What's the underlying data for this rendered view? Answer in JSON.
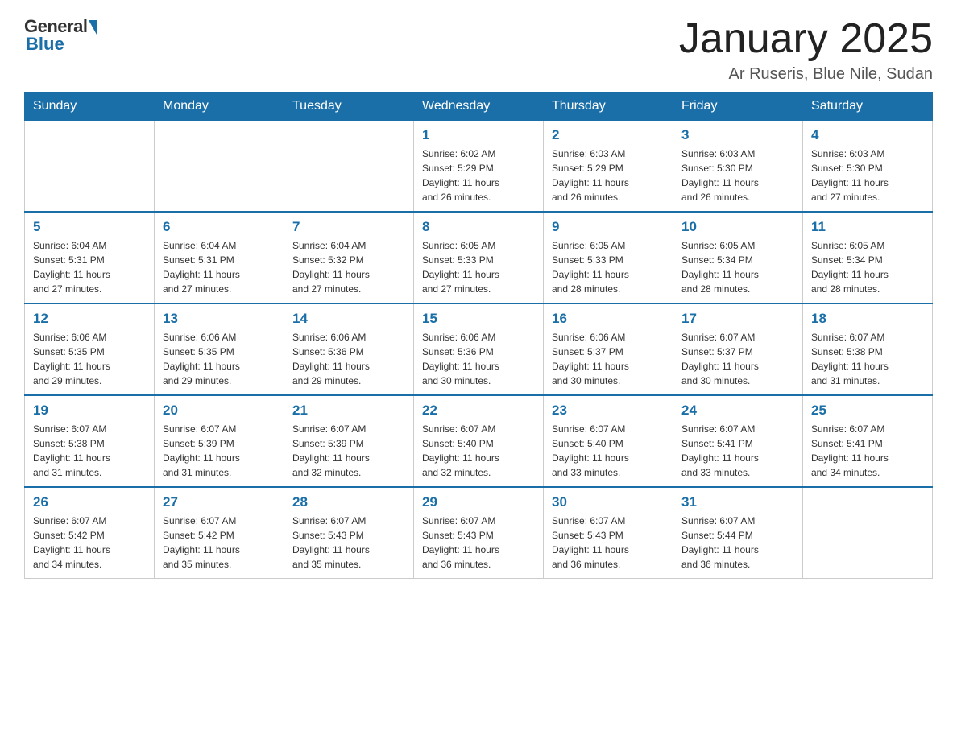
{
  "header": {
    "title": "January 2025",
    "location": "Ar Ruseris, Blue Nile, Sudan",
    "logo_general": "General",
    "logo_blue": "Blue"
  },
  "days_of_week": [
    "Sunday",
    "Monday",
    "Tuesday",
    "Wednesday",
    "Thursday",
    "Friday",
    "Saturday"
  ],
  "weeks": [
    [
      {
        "day": "",
        "info": ""
      },
      {
        "day": "",
        "info": ""
      },
      {
        "day": "",
        "info": ""
      },
      {
        "day": "1",
        "info": "Sunrise: 6:02 AM\nSunset: 5:29 PM\nDaylight: 11 hours\nand 26 minutes."
      },
      {
        "day": "2",
        "info": "Sunrise: 6:03 AM\nSunset: 5:29 PM\nDaylight: 11 hours\nand 26 minutes."
      },
      {
        "day": "3",
        "info": "Sunrise: 6:03 AM\nSunset: 5:30 PM\nDaylight: 11 hours\nand 26 minutes."
      },
      {
        "day": "4",
        "info": "Sunrise: 6:03 AM\nSunset: 5:30 PM\nDaylight: 11 hours\nand 27 minutes."
      }
    ],
    [
      {
        "day": "5",
        "info": "Sunrise: 6:04 AM\nSunset: 5:31 PM\nDaylight: 11 hours\nand 27 minutes."
      },
      {
        "day": "6",
        "info": "Sunrise: 6:04 AM\nSunset: 5:31 PM\nDaylight: 11 hours\nand 27 minutes."
      },
      {
        "day": "7",
        "info": "Sunrise: 6:04 AM\nSunset: 5:32 PM\nDaylight: 11 hours\nand 27 minutes."
      },
      {
        "day": "8",
        "info": "Sunrise: 6:05 AM\nSunset: 5:33 PM\nDaylight: 11 hours\nand 27 minutes."
      },
      {
        "day": "9",
        "info": "Sunrise: 6:05 AM\nSunset: 5:33 PM\nDaylight: 11 hours\nand 28 minutes."
      },
      {
        "day": "10",
        "info": "Sunrise: 6:05 AM\nSunset: 5:34 PM\nDaylight: 11 hours\nand 28 minutes."
      },
      {
        "day": "11",
        "info": "Sunrise: 6:05 AM\nSunset: 5:34 PM\nDaylight: 11 hours\nand 28 minutes."
      }
    ],
    [
      {
        "day": "12",
        "info": "Sunrise: 6:06 AM\nSunset: 5:35 PM\nDaylight: 11 hours\nand 29 minutes."
      },
      {
        "day": "13",
        "info": "Sunrise: 6:06 AM\nSunset: 5:35 PM\nDaylight: 11 hours\nand 29 minutes."
      },
      {
        "day": "14",
        "info": "Sunrise: 6:06 AM\nSunset: 5:36 PM\nDaylight: 11 hours\nand 29 minutes."
      },
      {
        "day": "15",
        "info": "Sunrise: 6:06 AM\nSunset: 5:36 PM\nDaylight: 11 hours\nand 30 minutes."
      },
      {
        "day": "16",
        "info": "Sunrise: 6:06 AM\nSunset: 5:37 PM\nDaylight: 11 hours\nand 30 minutes."
      },
      {
        "day": "17",
        "info": "Sunrise: 6:07 AM\nSunset: 5:37 PM\nDaylight: 11 hours\nand 30 minutes."
      },
      {
        "day": "18",
        "info": "Sunrise: 6:07 AM\nSunset: 5:38 PM\nDaylight: 11 hours\nand 31 minutes."
      }
    ],
    [
      {
        "day": "19",
        "info": "Sunrise: 6:07 AM\nSunset: 5:38 PM\nDaylight: 11 hours\nand 31 minutes."
      },
      {
        "day": "20",
        "info": "Sunrise: 6:07 AM\nSunset: 5:39 PM\nDaylight: 11 hours\nand 31 minutes."
      },
      {
        "day": "21",
        "info": "Sunrise: 6:07 AM\nSunset: 5:39 PM\nDaylight: 11 hours\nand 32 minutes."
      },
      {
        "day": "22",
        "info": "Sunrise: 6:07 AM\nSunset: 5:40 PM\nDaylight: 11 hours\nand 32 minutes."
      },
      {
        "day": "23",
        "info": "Sunrise: 6:07 AM\nSunset: 5:40 PM\nDaylight: 11 hours\nand 33 minutes."
      },
      {
        "day": "24",
        "info": "Sunrise: 6:07 AM\nSunset: 5:41 PM\nDaylight: 11 hours\nand 33 minutes."
      },
      {
        "day": "25",
        "info": "Sunrise: 6:07 AM\nSunset: 5:41 PM\nDaylight: 11 hours\nand 34 minutes."
      }
    ],
    [
      {
        "day": "26",
        "info": "Sunrise: 6:07 AM\nSunset: 5:42 PM\nDaylight: 11 hours\nand 34 minutes."
      },
      {
        "day": "27",
        "info": "Sunrise: 6:07 AM\nSunset: 5:42 PM\nDaylight: 11 hours\nand 35 minutes."
      },
      {
        "day": "28",
        "info": "Sunrise: 6:07 AM\nSunset: 5:43 PM\nDaylight: 11 hours\nand 35 minutes."
      },
      {
        "day": "29",
        "info": "Sunrise: 6:07 AM\nSunset: 5:43 PM\nDaylight: 11 hours\nand 36 minutes."
      },
      {
        "day": "30",
        "info": "Sunrise: 6:07 AM\nSunset: 5:43 PM\nDaylight: 11 hours\nand 36 minutes."
      },
      {
        "day": "31",
        "info": "Sunrise: 6:07 AM\nSunset: 5:44 PM\nDaylight: 11 hours\nand 36 minutes."
      },
      {
        "day": "",
        "info": ""
      }
    ]
  ]
}
